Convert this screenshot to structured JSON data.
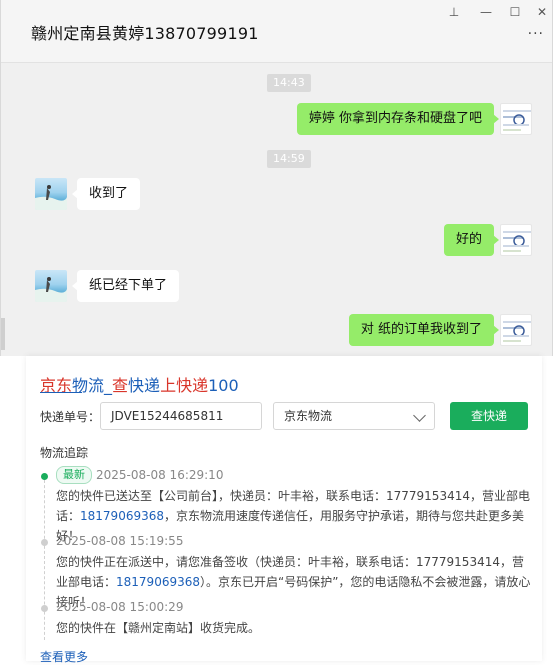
{
  "window": {
    "title": "赣州定南县黄婷13870799191",
    "controls": {
      "pin": "⊥",
      "minimize": "—",
      "maximize": "☐",
      "close": "✕"
    },
    "more": "···"
  },
  "messages": [
    {
      "type": "time",
      "text": "14:43"
    },
    {
      "type": "msg",
      "from": "me",
      "text": "婷婷  你拿到内存条和硬盘了吧"
    },
    {
      "type": "time",
      "text": "14:59"
    },
    {
      "type": "msg",
      "from": "other",
      "text": "收到了"
    },
    {
      "type": "msg",
      "from": "me",
      "text": "好的"
    },
    {
      "type": "msg",
      "from": "other",
      "text": "纸已经下单了"
    },
    {
      "type": "msg",
      "from": "me",
      "text": "对 纸的订单我收到了"
    }
  ],
  "express": {
    "brand": {
      "part1": "京东",
      "part2": "物流",
      "sep": "_",
      "part3": "查",
      "part4": "快递",
      "part5": "上",
      "part6": "快递",
      "part7": "100"
    },
    "tracking_label": "快递单号：",
    "tracking_value": "JDVE15244685811",
    "carrier_value": "京东物流",
    "query_button": "查快递",
    "trace_title": "物流追踪",
    "latest_badge": "最新",
    "events": [
      {
        "time": "2025-08-08 16:29:10",
        "text1": "您的快件已送达至【公司前台】，快递员：叶丰裕，联系电话：17779153414，营业部电话：",
        "phone": "18179069368",
        "text2": "，京东物流用速度传递信任，用服务守护承诺，期待与您共赴更多美好！"
      },
      {
        "time": "2025-08-08 15:19:55",
        "text1": "您的快件正在派送中，请您准备签收（快递员：叶丰裕，联系电话：17779153414，营业部电话：",
        "phone": "18179069368",
        "text2": "）。京东已开启“号码保护”，您的电话隐私不会被泄露，请放心接听！"
      },
      {
        "time": "2025-08-08 15:00:29",
        "text1": "您的快件在【赣州定南站】收货完成。"
      }
    ],
    "cut_text": "查看更多"
  }
}
